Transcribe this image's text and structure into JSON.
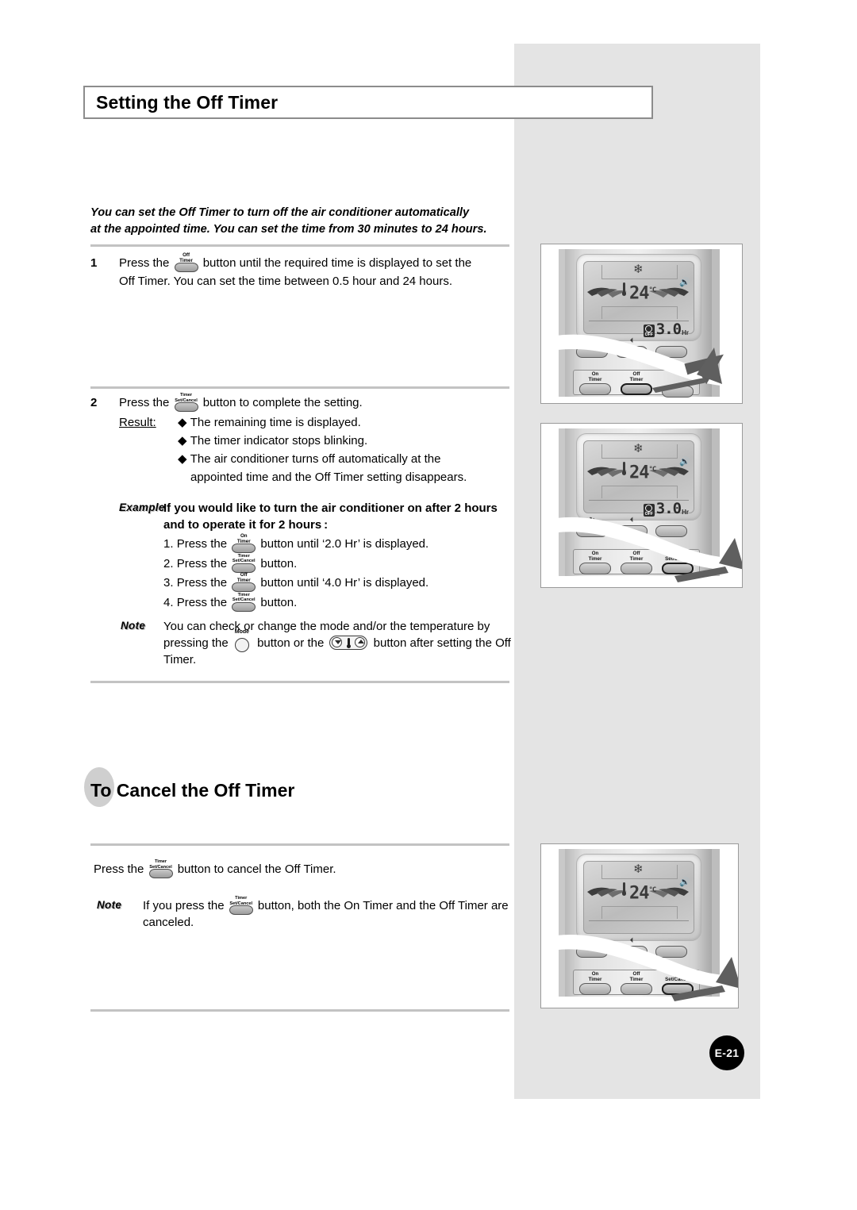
{
  "page": {
    "title": "Setting the Off Timer",
    "number": "E-21"
  },
  "intro": {
    "line1": "You can set the Off Timer to turn off the air conditioner automatically",
    "line2": "at the appointed time. You can set the time from 30 minutes to 24 hours."
  },
  "steps": [
    {
      "num": "1",
      "pre": "Press the",
      "button": {
        "line1": "Off",
        "line2": "Timer"
      },
      "post": "button until the required time is displayed to set the",
      "cont": "Off Timer. You can set the time between 0.5 hour and 24 hours."
    },
    {
      "num": "2",
      "pre": "Press the",
      "button": {
        "line1": "Timer",
        "line2": "Set/Cancel"
      },
      "post": "button to complete the setting.",
      "result_label": "Result:",
      "results": [
        "The remaining time is displayed.",
        "The timer indicator stops blinking.",
        "The air conditioner turns off automatically at the appointed time and the Off Timer setting disappears."
      ]
    }
  ],
  "example": {
    "tag": "Example",
    "head_line1": "If you would like to turn the air conditioner on after 2 hours",
    "head_line2": "and to operate it for 2 hours :",
    "items": [
      {
        "n": "1.",
        "pre": "Press the",
        "button": {
          "line1": "On",
          "line2": "Timer"
        },
        "post": "button until ‘2.0 Hr’ is displayed."
      },
      {
        "n": "2.",
        "pre": "Press the",
        "button": {
          "line1": "Timer",
          "line2": "Set/Cancel"
        },
        "post": "button."
      },
      {
        "n": "3.",
        "pre": "Press the",
        "button": {
          "line1": "Off",
          "line2": "Timer"
        },
        "post": "button until ‘4.0 Hr’ is displayed."
      },
      {
        "n": "4.",
        "pre": "Press the",
        "button": {
          "line1": "Timer",
          "line2": "Set/Cancel"
        },
        "post": "button."
      }
    ]
  },
  "note1": {
    "tag": "Note",
    "t1": "You can check or change the mode and/or the temperature by pressing the",
    "mode_label": "Mode",
    "t2": "button or the",
    "t3": "button after setting the Off Timer."
  },
  "section2": {
    "circle_text": "To",
    "title": "Cancel the Off Timer"
  },
  "cancel": {
    "pre": "Press the",
    "button": {
      "line1": "Timer",
      "line2": "Set/Cancel"
    },
    "post": "button to cancel the Off Timer."
  },
  "note2": {
    "tag": "Note",
    "t1": "If you press the",
    "button": {
      "line1": "Timer",
      "line2": "Set/Cancel"
    },
    "t2": "button,  both the On Timer and the Off Timer are canceled."
  },
  "remotes": [
    {
      "id": "remote-step1",
      "display": {
        "mode_icon": "snowflake-icon",
        "speaker_icon": "speaker-icon",
        "temperature": "24",
        "temperature_unit": "°C",
        "timer_mode": "OFF",
        "timer_value": "3.0",
        "timer_unit": "Hr",
        "timer_visible": true
      },
      "buttons": [
        {
          "line1": "On",
          "line2": "Timer",
          "highlighted": false
        },
        {
          "line1": "Off",
          "line2": "Timer",
          "highlighted": true
        },
        {
          "line1": "",
          "line2": "",
          "highlighted": false
        }
      ],
      "pointer": "off-timer"
    },
    {
      "id": "remote-step2",
      "display": {
        "mode_icon": "snowflake-icon",
        "speaker_icon": "speaker-icon",
        "temperature": "24",
        "temperature_unit": "°C",
        "timer_mode": "OFF",
        "timer_value": "3.0",
        "timer_unit": "Hr",
        "timer_visible": true
      },
      "buttons": [
        {
          "line1": "On",
          "line2": "Timer",
          "highlighted": false
        },
        {
          "line1": "Off",
          "line2": "Timer",
          "highlighted": false
        },
        {
          "line1": "Timer",
          "line2": "Set/Cancel",
          "highlighted": true
        }
      ],
      "pointer": "timer-set-cancel"
    },
    {
      "id": "remote-cancel",
      "display": {
        "mode_icon": "snowflake-icon",
        "speaker_icon": "speaker-icon",
        "temperature": "24",
        "temperature_unit": "°C",
        "timer_mode": "",
        "timer_value": "",
        "timer_unit": "",
        "timer_visible": false
      },
      "buttons": [
        {
          "line1": "On",
          "line2": "Timer",
          "highlighted": false
        },
        {
          "line1": "Off",
          "line2": "Timer",
          "highlighted": false
        },
        {
          "line1": "Timer",
          "line2": "Set/Cancel",
          "highlighted": true
        }
      ],
      "pointer": "timer-set-cancel"
    }
  ],
  "colors": {
    "panel_gray": "#e4e4e4",
    "rule_gray": "#c3c3c3",
    "title_border": "#8c8c8c",
    "page_badge": "#000000"
  }
}
